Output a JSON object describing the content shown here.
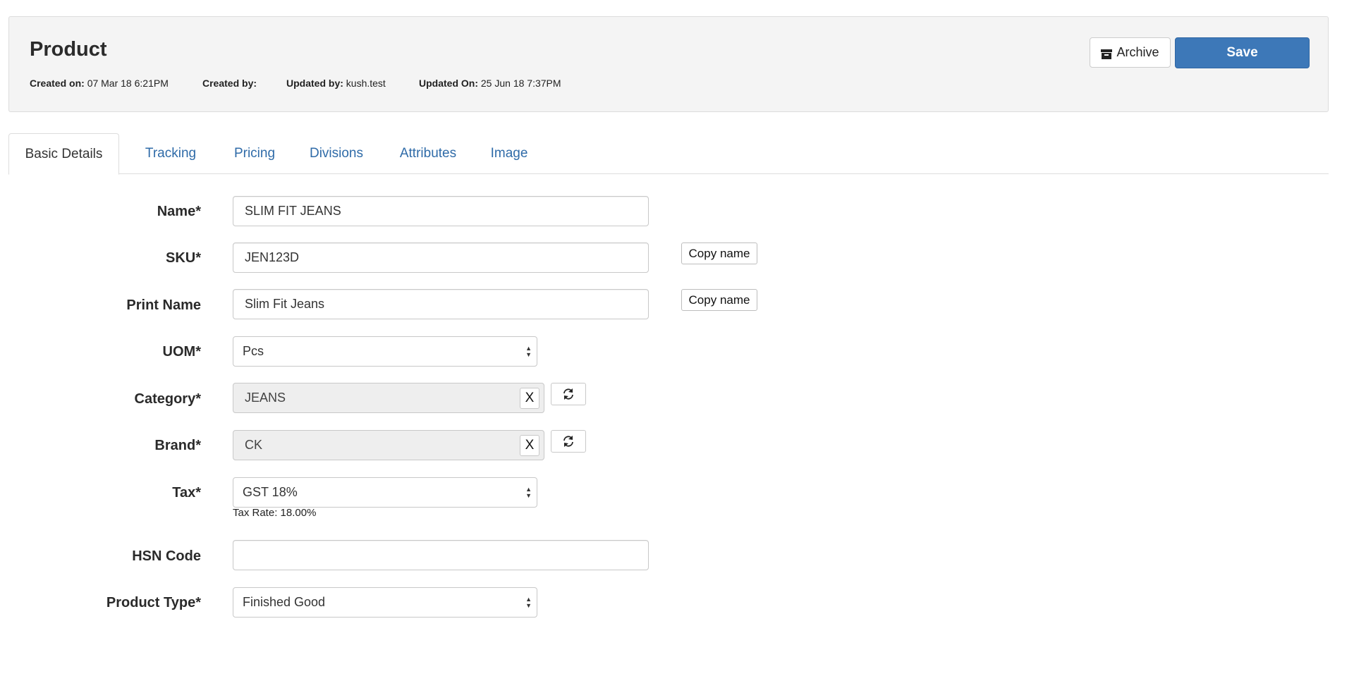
{
  "header": {
    "title": "Product",
    "meta": [
      {
        "label": "Created on:",
        "value": "07 Mar 18 6:21PM"
      },
      {
        "label": "Created by:",
        "value": ""
      },
      {
        "label": "Updated by:",
        "value": "kush.test"
      },
      {
        "label": "Updated On:",
        "value": "25 Jun 18 7:37PM"
      }
    ],
    "archive_label": "Archive",
    "save_label": "Save"
  },
  "tabs": [
    {
      "label": "Basic Details",
      "active": true
    },
    {
      "label": "Tracking",
      "active": false
    },
    {
      "label": "Pricing",
      "active": false
    },
    {
      "label": "Divisions",
      "active": false
    },
    {
      "label": "Attributes",
      "active": false
    },
    {
      "label": "Image",
      "active": false
    }
  ],
  "form": {
    "name": {
      "label": "Name*",
      "value": "SLIM FIT JEANS"
    },
    "sku": {
      "label": "SKU*",
      "value": "JEN123D",
      "copy_label": "Copy name"
    },
    "print_name": {
      "label": "Print Name",
      "value": "Slim Fit Jeans",
      "copy_label": "Copy name"
    },
    "uom": {
      "label": "UOM*",
      "value": "Pcs"
    },
    "category": {
      "label": "Category*",
      "value": "JEANS",
      "clear_label": "X"
    },
    "brand": {
      "label": "Brand*",
      "value": "CK",
      "clear_label": "X"
    },
    "tax": {
      "label": "Tax*",
      "value": "GST 18%",
      "rate_text": "Tax Rate: 18.00%"
    },
    "hsn_code": {
      "label": "HSN Code",
      "value": ""
    },
    "product_type": {
      "label": "Product Type*",
      "value": "Finished Good"
    }
  },
  "icons": {
    "archive": "archive-box-icon",
    "refresh": "refresh-icon",
    "select": "select-arrows-icon"
  },
  "colors": {
    "primary": "#3d78b8",
    "link": "#2f6ba8",
    "panel_bg": "#f4f4f4",
    "readonly_bg": "#eeeeee"
  }
}
